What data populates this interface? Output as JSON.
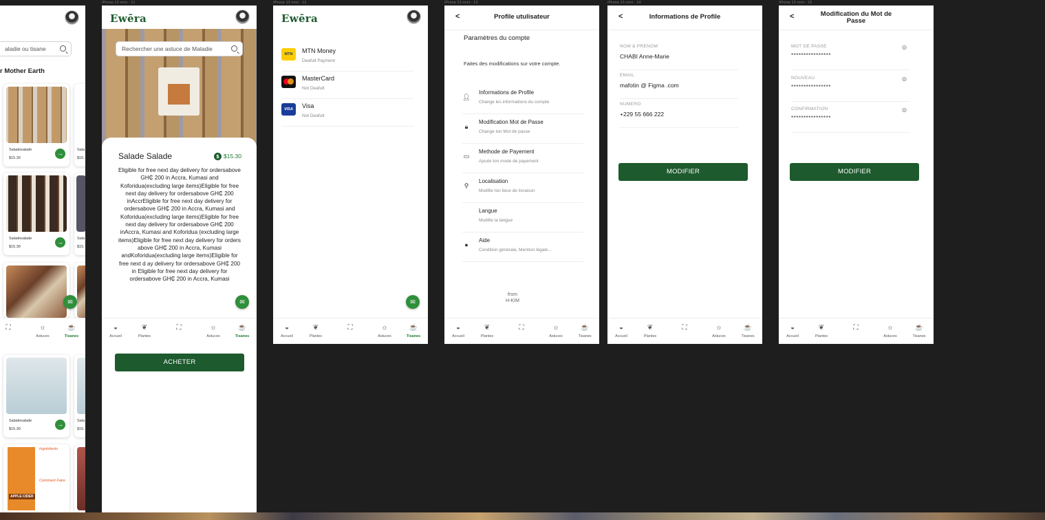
{
  "app": {
    "logo": "Ewēra"
  },
  "frames": {
    "labels": [
      "iPhone 13 mini - 10",
      "iPhone 13 mini - 11",
      "iPhone 13 mini - 12",
      "iPhone 13 mini - 13",
      "iPhone 13 mini - 14",
      "iPhone 13 mini - 15"
    ]
  },
  "nav": {
    "home": "Accueil",
    "plants": "Plantes",
    "tips": "Astuces",
    "teas": "Tisanes"
  },
  "catalog": {
    "search_placeholder": "aladie ou tisane",
    "section_title": "r Mother Earth",
    "products": [
      {
        "name": "Saladesalade",
        "price": "$15.30"
      },
      {
        "name": "Saladesalade",
        "price": "$15.30"
      },
      {
        "name": "Saladesalade",
        "price": "$15.30"
      }
    ],
    "cropped_names": [
      "Sala",
      "Sala",
      "Sala"
    ],
    "cropped_prices": [
      "$15.",
      "$15.",
      "$15."
    ],
    "ingredients_title": "Ingrédients",
    "howto_title": "Comment Faire",
    "cider_brand": "APPLE CIDER"
  },
  "detail": {
    "search_placeholder": "Rechercher une astuce de Maladie",
    "title": "Salade Salade",
    "price": "$15.30",
    "currency_symbol": "$",
    "description": "Eligible for free next day delivery for ordersabove GH₵ 200 in Accra, Kumasi and Koforidua(excluding large items)Eligible for free next day delivery for ordersabove GH₵ 200 inAccrEligible for free next day delivery for ordersabove GH₵ 200 in Accra, Kumasi and Koforidua(excluding large items)Eligible for free next day delivery for ordersabove GH₵ 200 inAccra, Kumasi and Koforidua (excluding large items)Eligible for free next day delivery for orders above GH₵ 200 in Accra, Kumasi andKoforidua(excluding large items)Eligible for free next d ay delivery for ordersabove GH₵ 200 in Eligible for free next day delivery for ordersabove GH₵ 200 in Accra, Kumasi",
    "buy_label": "ACHETER"
  },
  "payments": {
    "methods": [
      {
        "name": "MTN Money",
        "sub": "Deafult Payment",
        "logo": "MTN"
      },
      {
        "name": "MasterCard",
        "sub": "Not Deafult",
        "logo": "MC"
      },
      {
        "name": "Visa",
        "sub": "Not Deafult",
        "logo": "VISA"
      }
    ]
  },
  "profile": {
    "back": "<",
    "title": "Profile utulisateur",
    "section": "Paramètres du compte",
    "intro": "Faites des modifications sur votre compte.",
    "items": [
      {
        "title": "Informations de Profile",
        "sub": "Change les informations du compte",
        "icon": "person-icon"
      },
      {
        "title": "Modification Mot de Passe",
        "sub": "Change ton Mot de passe",
        "icon": "lock-icon"
      },
      {
        "title": "Methode de Payement",
        "sub": "Ajoute ton mode de payement",
        "icon": "card-icon"
      },
      {
        "title": "Localisation",
        "sub": "Modifie ton lieux de livraison",
        "icon": "location-icon"
      },
      {
        "title": "Langue",
        "sub": "Modifie la langue",
        "icon": ""
      },
      {
        "title": "Aide",
        "sub": "Condition générale, Mention légale...",
        "icon": "info-icon"
      }
    ],
    "footer_from": "from",
    "footer_brand": "H-KIM"
  },
  "info": {
    "back": "<",
    "title": "Informations de Profile",
    "fields": [
      {
        "label": "NOM & PRENOM",
        "value": "CHABI Anne-Marie"
      },
      {
        "label": "EMAIL",
        "value": "mafotin @ Figma .com"
      },
      {
        "label": "NUMERO",
        "value": "+229 55 666 222"
      }
    ],
    "submit": "MODIFIER"
  },
  "password": {
    "back": "<",
    "title_line1": "Modification du  Mot de",
    "title_line2": "Passe",
    "fields": [
      {
        "label": "MOT DE PASSE",
        "mask": "****************"
      },
      {
        "label": "NOUVEAU",
        "mask": "****************"
      },
      {
        "label": "CONFIRMATION",
        "mask": "****************"
      }
    ],
    "submit": "MODIFIER"
  },
  "colors": {
    "primary": "#1d5a2d",
    "accent": "#2f8f3a",
    "canvas": "#1e1e1e"
  }
}
